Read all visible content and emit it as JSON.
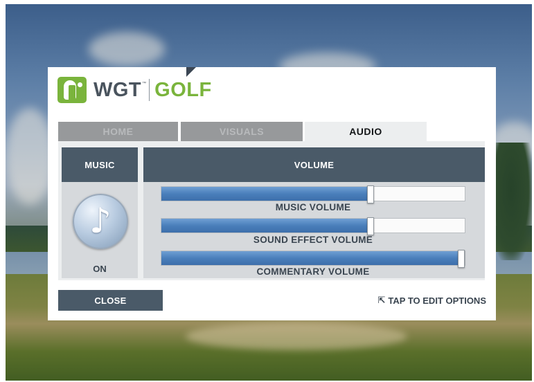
{
  "logo": {
    "wgt": "WGT",
    "tm": "™",
    "golf": "GOLF"
  },
  "tabs": [
    {
      "label": "HOME",
      "active": false
    },
    {
      "label": "VISUALS",
      "active": false
    },
    {
      "label": "AUDIO",
      "active": true
    }
  ],
  "music": {
    "header": "MUSIC",
    "state": "ON",
    "icon": "music-note-icon"
  },
  "volume": {
    "header": "VOLUME",
    "sliders": [
      {
        "label": "MUSIC VOLUME",
        "value": 0.69
      },
      {
        "label": "SOUND EFFECT VOLUME",
        "value": 0.69
      },
      {
        "label": "COMMENTARY VOLUME",
        "value": 1.0
      }
    ]
  },
  "close_label": "CLOSE",
  "hint": {
    "arrow": "⇱",
    "text": "TAP TO EDIT OPTIONS"
  },
  "colors": {
    "accent": "#7ab43c",
    "header_bg": "#4a5a68",
    "slider_fill": "#4a7fbb"
  }
}
